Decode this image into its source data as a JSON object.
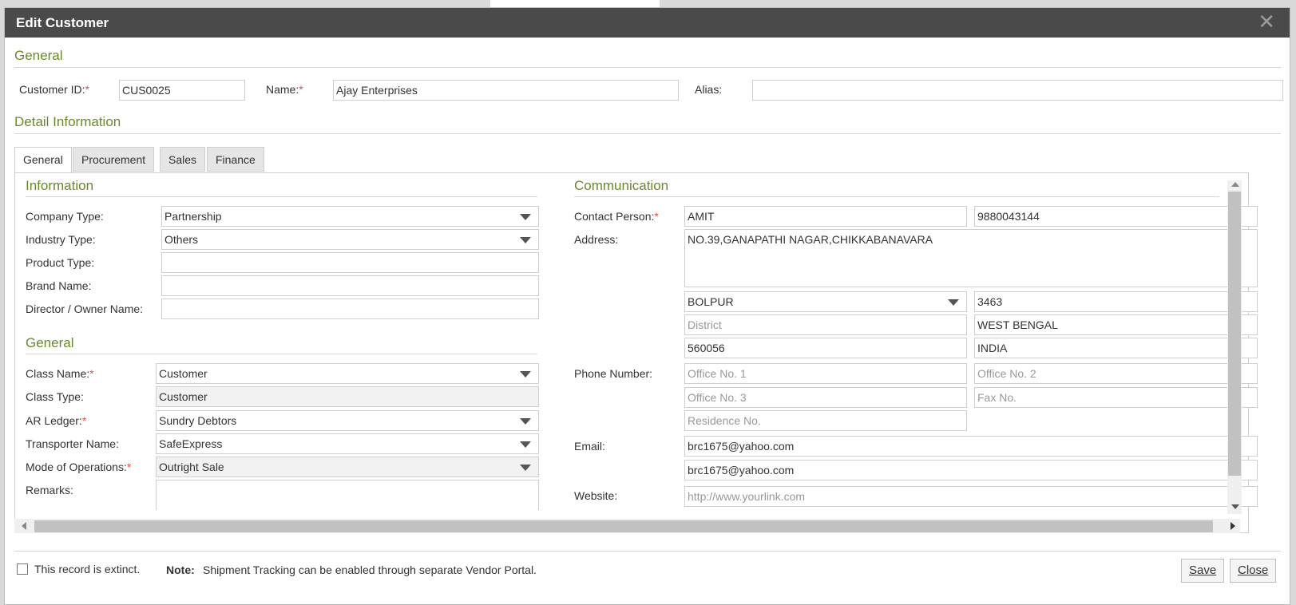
{
  "dialog": {
    "title": "Edit Customer",
    "close_glyph": "✕"
  },
  "general_section": {
    "title": "General",
    "customer_id_label": "Customer ID:",
    "customer_id_value": "CUS0025",
    "name_label": "Name:",
    "name_value": "Ajay Enterprises",
    "alias_label": "Alias:",
    "alias_value": ""
  },
  "detail": {
    "title": "Detail Information",
    "tabs": [
      "General",
      "Procurement",
      "Sales",
      "Finance"
    ],
    "active_tab": "General"
  },
  "information": {
    "title": "Information",
    "company_type_label": "Company Type:",
    "company_type_value": "Partnership",
    "industry_type_label": "Industry Type:",
    "industry_type_value": "Others",
    "product_type_label": "Product Type:",
    "product_type_value": "",
    "brand_name_label": "Brand Name:",
    "brand_name_value": "",
    "director_label": "Director / Owner Name:",
    "director_value": ""
  },
  "general_sub": {
    "title": "General",
    "class_name_label": "Class Name:",
    "class_name_value": "Customer",
    "class_type_label": "Class Type:",
    "class_type_value": "Customer",
    "ar_ledger_label": "AR Ledger:",
    "ar_ledger_value": "Sundry Debtors",
    "transporter_label": "Transporter Name:",
    "transporter_value": "SafeExpress",
    "mode_label": "Mode of Operations:",
    "mode_value": "Outright Sale",
    "remarks_label": "Remarks:",
    "remarks_value": ""
  },
  "communication": {
    "title": "Communication",
    "contact_person_label": "Contact Person:",
    "contact_person_value": "AMIT",
    "contact_phone_value": "9880043144",
    "address_label": "Address:",
    "address_value": "NO.39,GANAPATHI NAGAR,CHIKKABANAVARA",
    "city_value": "BOLPUR",
    "city_code_value": "3463",
    "district_placeholder": "District",
    "state_value": "WEST BENGAL",
    "pincode_value": "560056",
    "country_value": "INDIA",
    "phone_label": "Phone Number:",
    "office1_placeholder": "Office No. 1",
    "office2_placeholder": "Office No. 2",
    "office3_placeholder": "Office No. 3",
    "fax_placeholder": "Fax No.",
    "residence_placeholder": "Residence No.",
    "email_label": "Email:",
    "email1_value": "brc1675@yahoo.com",
    "email2_value": "brc1675@yahoo.com",
    "website_label": "Website:",
    "website_placeholder": "http://www.yourlink.com"
  },
  "footer": {
    "extinct_label": "This record is extinct.",
    "extinct_checked": false,
    "note_label": "Note:",
    "note_text": "Shipment Tracking can be enabled through separate Vendor Portal.",
    "save_label": "Save",
    "close_label": "Close"
  },
  "colors": {
    "titlebar": "#4a4a4a",
    "section_title": "#6a8a2a",
    "required": "#d9534f"
  }
}
